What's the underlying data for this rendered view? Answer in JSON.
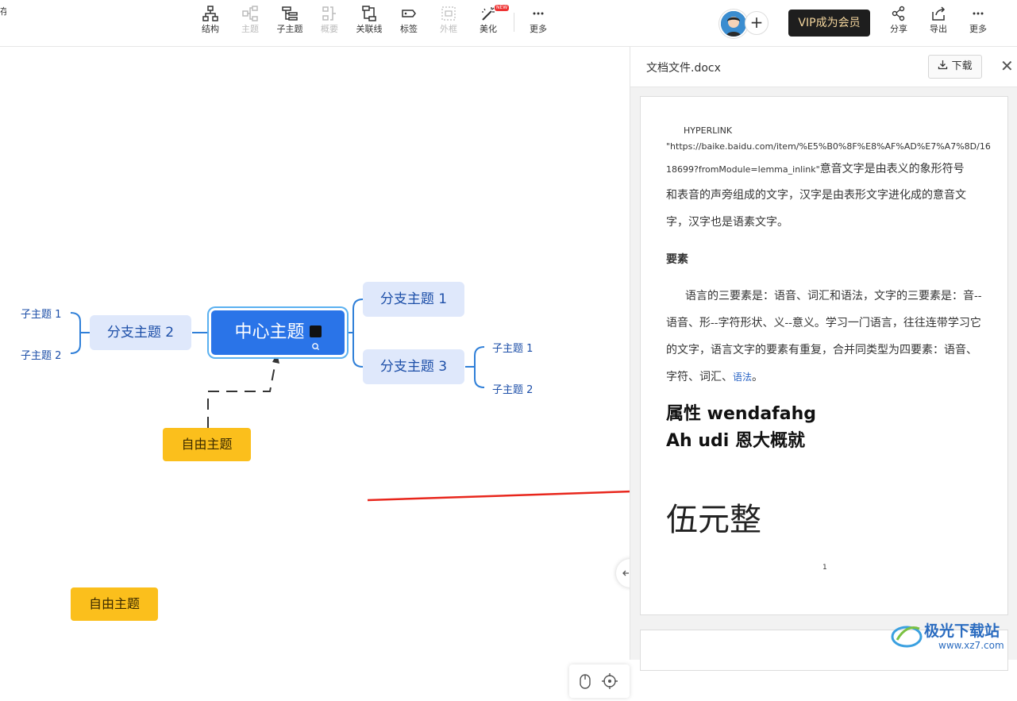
{
  "toolbar": {
    "left_edge": "存",
    "items": [
      {
        "label": "结构",
        "icon": "structure-icon",
        "disabled": false
      },
      {
        "label": "主题",
        "icon": "topic-icon",
        "disabled": true
      },
      {
        "label": "子主题",
        "icon": "subtopic-icon",
        "disabled": false
      },
      {
        "label": "概要",
        "icon": "summary-icon",
        "disabled": true
      },
      {
        "label": "关联线",
        "icon": "relation-line-icon",
        "disabled": false
      },
      {
        "label": "标签",
        "icon": "tag-icon",
        "disabled": false
      },
      {
        "label": "外框",
        "icon": "boundary-icon",
        "disabled": true
      },
      {
        "label": "美化",
        "icon": "beautify-wand-icon",
        "disabled": false,
        "badge": "NEW"
      },
      {
        "label": "更多",
        "icon": "more-dots-icon",
        "disabled": false
      }
    ],
    "vip_label": "VIP成为会员",
    "right_items": [
      {
        "label": "分享",
        "icon": "share-icon"
      },
      {
        "label": "导出",
        "icon": "export-icon"
      },
      {
        "label": "更多",
        "icon": "more-dots-icon"
      }
    ]
  },
  "mindmap": {
    "center": "中心主题",
    "branches": [
      "分支主题 1",
      "分支主题 2",
      "分支主题 3"
    ],
    "branch2_subs": [
      "子主题 1",
      "子主题 2"
    ],
    "branch3_subs": [
      "子主题 1",
      "子主题 2"
    ],
    "free_topics": [
      "自由主题",
      "自由主题"
    ]
  },
  "panel": {
    "title": "文档文件.docx",
    "download_label": "下载",
    "doc": {
      "hyperlink_field": "HYPERLINK",
      "url_line1": "\"https://baike.baidu.com/item/%E5%B0%8F%E8%AF%AD%E7%A7%8D/16",
      "url_line2": "18699?fromModule=lemma_inlink\"",
      "url_line2_text": "意音文字是由表义的象形符号",
      "para1_rest": "和表音的声旁组成的文字，汉字是由表形文字进化成的意音文字，汉字也是语素文字。",
      "heading": "要素",
      "para2": "语言的三要素是：语音、词汇和语法，文字的三要素是：音--语音、形--字符形状、义--意义。学习一门语言，往往连带学习它的文字，语言文字的要素有重复，合并同类型为四要素：语音、字符、词汇、",
      "para2_link": "语法",
      "para2_end": "。",
      "bold_line1": "属性 wendafahg",
      "bold_line2": "Ah udi 恩大概就",
      "big_text": "伍元整",
      "page_number": "1"
    }
  },
  "watermark": {
    "text": "极光下载站",
    "url": "www.xz7.com"
  }
}
